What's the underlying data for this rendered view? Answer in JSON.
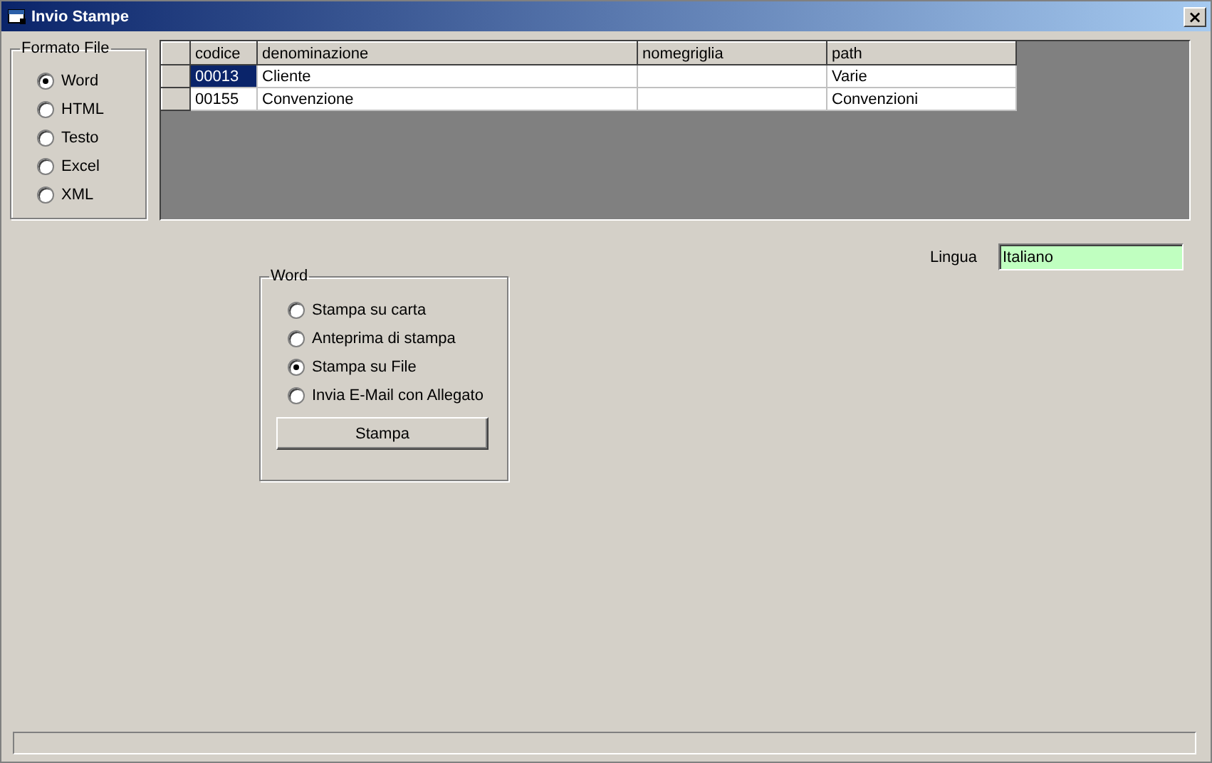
{
  "window": {
    "title": "Invio Stampe",
    "close": "×"
  },
  "format_frame": {
    "title": "Formato File",
    "options": [
      {
        "label": "Word",
        "selected": true
      },
      {
        "label": "HTML",
        "selected": false
      },
      {
        "label": "Testo",
        "selected": false
      },
      {
        "label": "Excel",
        "selected": false
      },
      {
        "label": "XML",
        "selected": false
      }
    ]
  },
  "grid": {
    "columns": [
      "codice",
      "denominazione",
      "nomegriglia",
      "path"
    ],
    "rows": [
      {
        "selected": true,
        "cells": [
          "00013",
          "Cliente",
          "",
          "Varie"
        ]
      },
      {
        "selected": false,
        "cells": [
          "00155",
          "Convenzione",
          "",
          "Convenzioni"
        ]
      }
    ]
  },
  "language": {
    "label": "Lingua",
    "value": "Italiano"
  },
  "output_frame": {
    "title": "Word",
    "options": [
      {
        "label": "Stampa su carta",
        "selected": false
      },
      {
        "label": "Anteprima di stampa",
        "selected": false
      },
      {
        "label": "Stampa su File",
        "selected": true
      },
      {
        "label": "Invia E-Mail con Allegato",
        "selected": false
      }
    ],
    "button": "Stampa"
  },
  "progress_bar": {
    "level": 0
  }
}
